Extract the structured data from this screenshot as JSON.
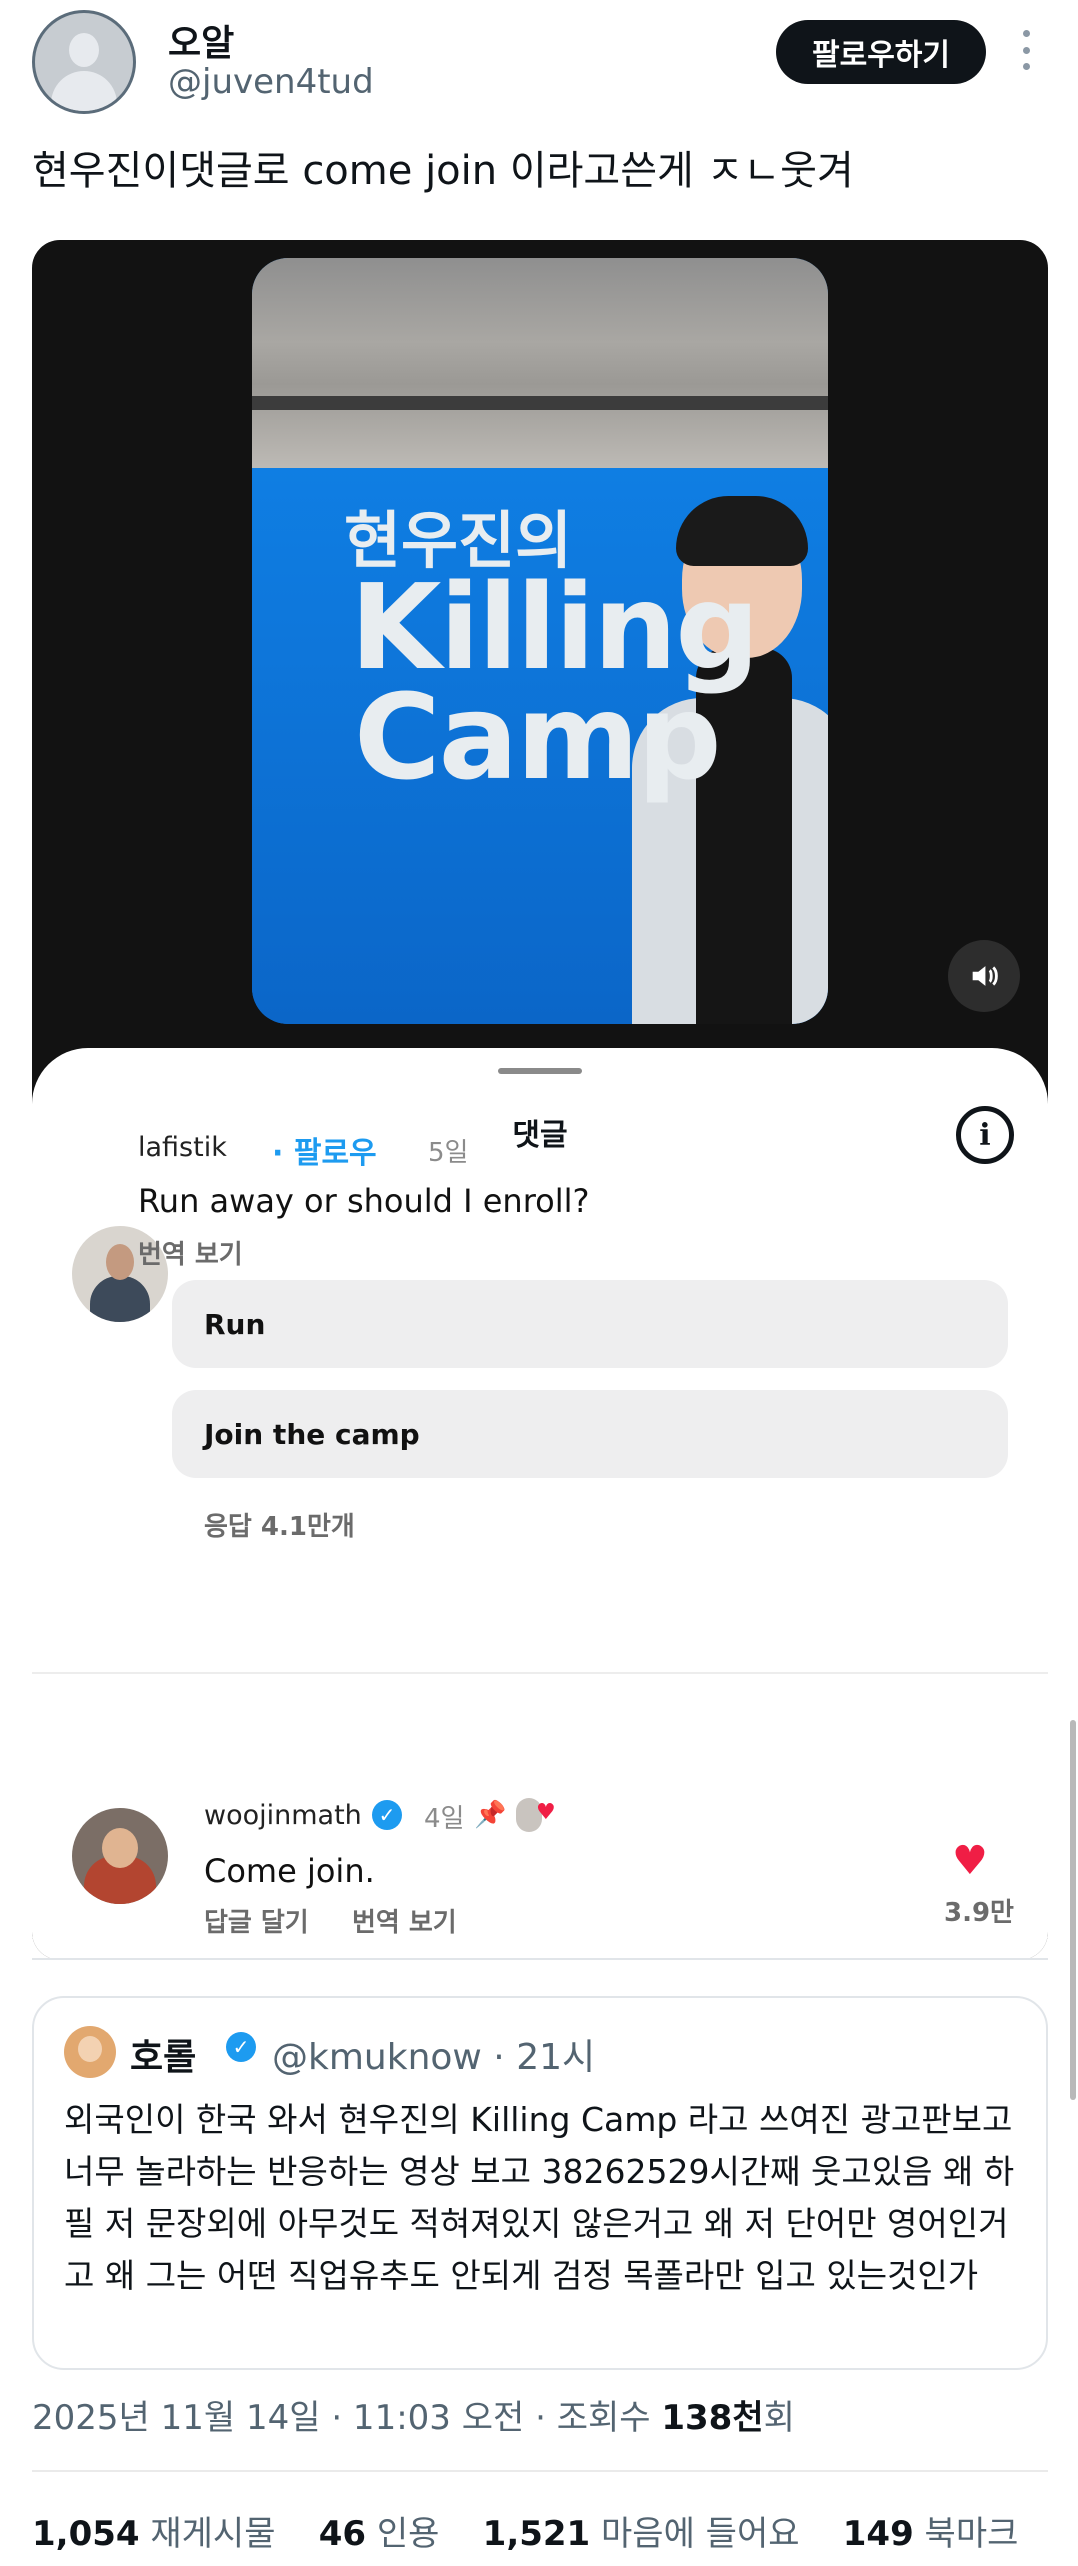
{
  "author": {
    "display_name": "오알",
    "handle": "@juven4tud",
    "follow_label": "팔로우하기"
  },
  "tweet": {
    "text": "현우진이댓글로 come join 이라고쓴게 ㅈㄴ웃겨"
  },
  "video": {
    "banner_line1": "현우진의",
    "banner_line2": "Killing",
    "banner_line3": "Camp"
  },
  "comments_sheet": {
    "title": "댓글",
    "comment1": {
      "user": "lafistik",
      "follow": "· 팔로우",
      "time": "5일",
      "text": "Run away or should I enroll?",
      "translate": "번역 보기",
      "replies": [
        "Run",
        "Join the camp"
      ],
      "reply_count": "응답 4.1만개"
    },
    "comment2": {
      "user": "woojinmath",
      "time": "4일",
      "text": "Come join.",
      "reply": "답글 달기",
      "translate": "번역 보기",
      "likes": "3.9만"
    }
  },
  "quote": {
    "name": "호롤",
    "handle": "@kmuknow · 21시",
    "text": "외국인이 한국 와서 현우진의 Killing Camp 라고 쓰여진 광고판보고 너무 놀라하는 반응하는 영상 보고 38262529시간째 웃고있음 왜 하필 저 문장외에 아무것도 적혀져있지 않은거고 왜 저 단어만 영어인거고 왜 그는 어떤 직업유추도 안되게 검정 목폴라만 입고 있는것인가"
  },
  "meta": {
    "datetime": "2025년 11월 14일 · 11:03 오전 · 조회수 ",
    "views": "138천",
    "views_suffix": "회"
  },
  "stats": {
    "reposts": "1,054",
    "reposts_label": "재게시물",
    "quotes": "46",
    "quotes_label": "인용",
    "likes": "1,521",
    "likes_label": "마음에 들어요",
    "bookmarks": "149",
    "bookmarks_label": "북마크"
  },
  "colors": {
    "accent": "#1d9bf0",
    "like": "#f01e45",
    "text": "#0f1419",
    "muted": "#536471"
  },
  "icons": [
    "more-icon",
    "volume-icon",
    "info-icon",
    "verified-icon",
    "pin-icon",
    "heart-icon"
  ]
}
